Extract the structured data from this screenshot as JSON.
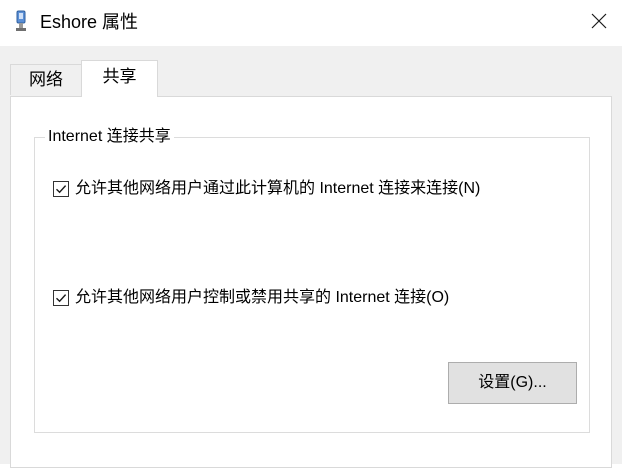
{
  "window": {
    "title": "Eshore 属性",
    "icon": "network-adapter-icon",
    "close_glyph": "✕"
  },
  "tabs": [
    {
      "label": "网络",
      "selected": false
    },
    {
      "label": "共享",
      "selected": true
    }
  ],
  "sharing": {
    "group_title": "Internet 连接共享",
    "options": [
      {
        "label": "允许其他网络用户通过此计算机的 Internet 连接来连接(N)",
        "checked": true
      },
      {
        "label": "允许其他网络用户控制或禁用共享的 Internet 连接(O)",
        "checked": true
      }
    ],
    "settings_button": "设置(G)..."
  }
}
